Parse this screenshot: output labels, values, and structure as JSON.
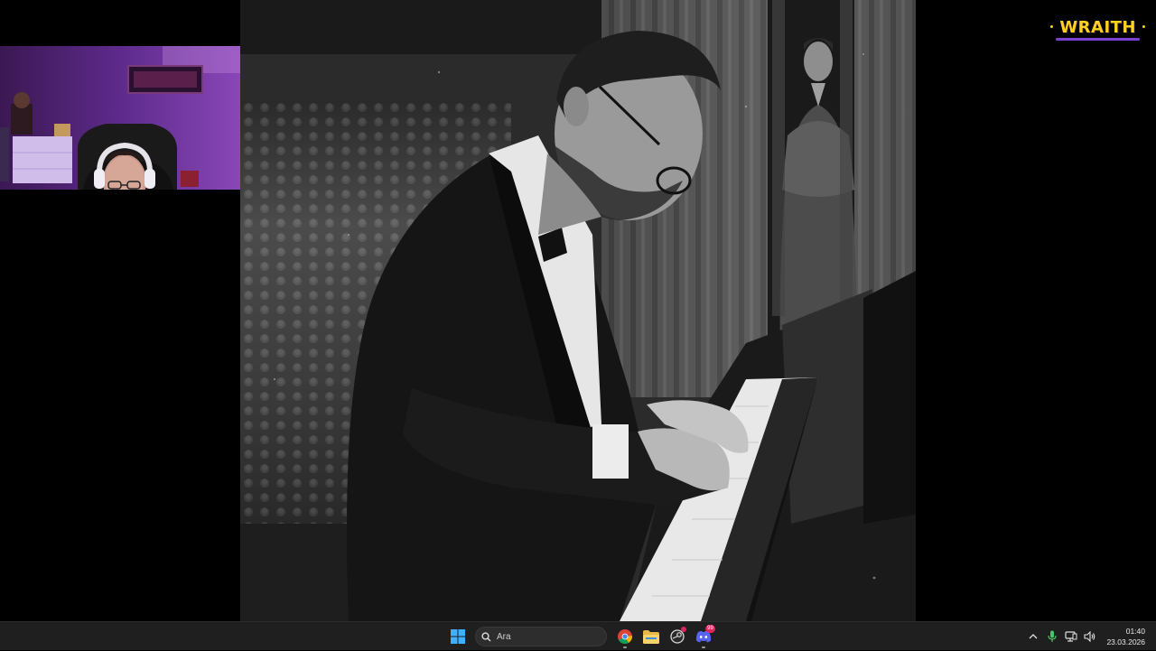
{
  "overlay": {
    "brand_logo": "WRAITH"
  },
  "taskbar": {
    "start_icon": "windows-start-icon",
    "search_placeholder": "Ara",
    "pinned_apps": [
      {
        "name": "Google Chrome",
        "icon": "chrome-icon",
        "running": true
      },
      {
        "name": "File Explorer",
        "icon": "folder-icon",
        "running": false
      },
      {
        "name": "Steam-like App",
        "icon": "app-icon",
        "running": false,
        "notification": true
      },
      {
        "name": "Discord",
        "icon": "discord-icon",
        "running": true,
        "badge": "99"
      }
    ],
    "tray": {
      "icons": [
        "chevron-up-icon",
        "microphone-icon",
        "network-icon",
        "speaker-icon"
      ],
      "time": "01:40",
      "date": "23.03.2026"
    }
  },
  "colors": {
    "taskbar_bg": "#1f1f1f",
    "brand_yellow": "#ffd21f",
    "brand_purple": "#7b3fd6",
    "notification_red": "#e0245e",
    "webcam_purple": "#5b2a86"
  }
}
